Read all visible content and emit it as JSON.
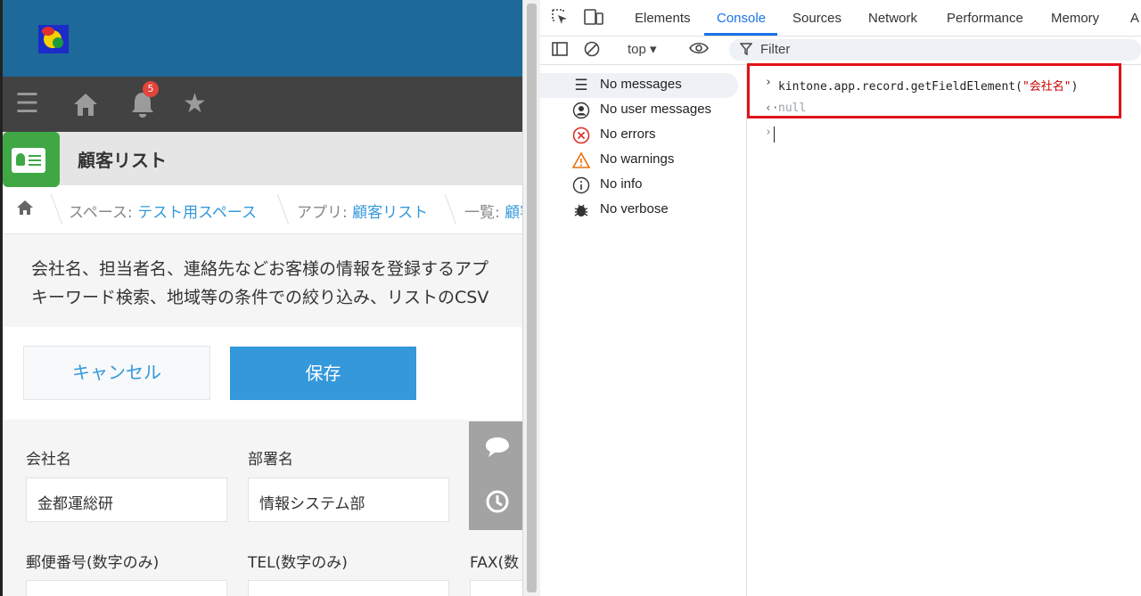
{
  "app": {
    "notification_count": "5",
    "title": "顧客リスト",
    "breadcrumb": {
      "space_label": "スペース: ",
      "space_link": "テスト用スペース",
      "app_label": "アプリ: ",
      "app_link": "顧客リスト",
      "view_label": "一覧: ",
      "view_link": "顧客"
    },
    "description": [
      "会社名、担当者名、連絡先などお客様の情報を登録するアプ",
      "キーワード検索、地域等の条件での絞り込み、リストのCSV"
    ],
    "buttons": {
      "cancel": "キャンセル",
      "save": "保存"
    },
    "fields": {
      "company_label": "会社名",
      "company_value": "金都運総研",
      "department_label": "部署名",
      "department_value": "情報システム部",
      "zip_label": "郵便番号(数字のみ)",
      "tel_label": "TEL(数字のみ)",
      "fax_label": "FAX(数"
    }
  },
  "devtools": {
    "tabs": [
      "Elements",
      "Console",
      "Sources",
      "Network",
      "Performance",
      "Memory",
      "A"
    ],
    "active_tab": "Console",
    "context": "top",
    "filter_placeholder": "Filter",
    "sidebar": [
      {
        "label": "No messages",
        "icon": "list-icon"
      },
      {
        "label": "No user messages",
        "icon": "user-icon"
      },
      {
        "label": "No errors",
        "icon": "error-icon"
      },
      {
        "label": "No warnings",
        "icon": "warning-icon"
      },
      {
        "label": "No info",
        "icon": "info-icon"
      },
      {
        "label": "No verbose",
        "icon": "bug-icon"
      }
    ],
    "console": {
      "input_prefix": "kintone.app.record.getFieldElement(",
      "input_string": "\"会社名\"",
      "input_suffix": ")",
      "output": "null"
    }
  },
  "colors": {
    "header_blue": "#1d6a9a",
    "kintone_blue": "#3498db",
    "devtools_blue": "#1a73e8",
    "highlight_red": "#e0121a"
  }
}
